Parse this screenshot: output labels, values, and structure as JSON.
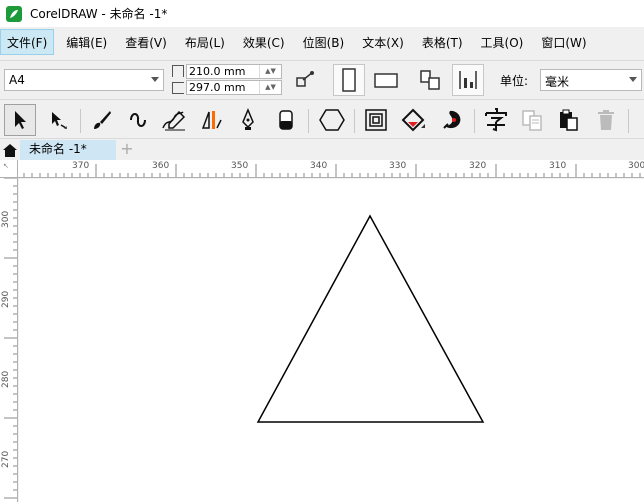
{
  "window": {
    "title": "CorelDRAW - 未命名 -1*"
  },
  "menu": [
    {
      "label": "文件(F)",
      "active": true
    },
    {
      "label": "编辑(E)"
    },
    {
      "label": "查看(V)"
    },
    {
      "label": "布局(L)"
    },
    {
      "label": "效果(C)"
    },
    {
      "label": "位图(B)"
    },
    {
      "label": "文本(X)"
    },
    {
      "label": "表格(T)"
    },
    {
      "label": "工具(O)"
    },
    {
      "label": "窗口(W)"
    }
  ],
  "property_bar": {
    "page_size": "A4",
    "width": "210.0 mm",
    "height": "297.0 mm",
    "unit_label": "单位:",
    "unit_value": "毫米"
  },
  "document_tab": {
    "label": "未命名 -1*",
    "add_symbol": "+"
  },
  "ruler": {
    "horizontal_labels": [
      "370",
      "360",
      "350",
      "340",
      "330",
      "320",
      "310",
      "300"
    ],
    "vertical_labels": [
      "300",
      "290",
      "280",
      "270"
    ],
    "corner_symbol": "↖"
  },
  "shape": {
    "type": "triangle",
    "stroke": "#000000",
    "fill": "#ffffff"
  },
  "colors": {
    "menu_active_bg": "#cce8f4",
    "tab_bg": "#cfe6f5",
    "brand_green": "#1d9b3a",
    "accent_orange": "#ff6a00",
    "accent_red": "#e02020"
  }
}
